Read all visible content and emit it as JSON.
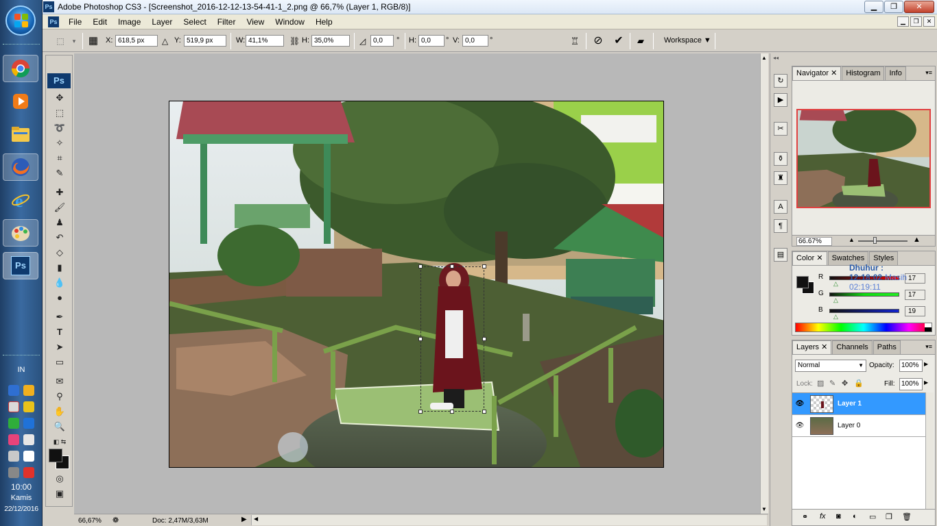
{
  "taskbar": {
    "apps": [
      "Chrome",
      "Media Player",
      "File Explorer",
      "Firefox",
      "Internet Explorer",
      "Paint",
      "Photoshop"
    ],
    "lang": "IN",
    "time": "10:00",
    "day": "Kamis",
    "date": "22/12/2016"
  },
  "window": {
    "title": "Adobe Photoshop CS3 - [Screenshot_2016-12-12-13-54-41-1_2.png @ 66,7% (Layer 1, RGB/8)]",
    "ps_logo": "Ps"
  },
  "menu": [
    "File",
    "Edit",
    "Image",
    "Layer",
    "Select",
    "Filter",
    "View",
    "Window",
    "Help"
  ],
  "options": {
    "x_label": "X:",
    "x_value": "618,5 px",
    "y_label": "Y:",
    "y_value": "519,9 px",
    "w_label": "W:",
    "w_value": "41,1%",
    "h_label": "H:",
    "h_value": "35,0%",
    "angle_value": "0,0",
    "deg": "°",
    "hskew_label": "H:",
    "hskew_value": "0,0",
    "vskew_label": "V:",
    "vskew_value": "0,0",
    "workspace": "Workspace"
  },
  "status": {
    "zoom": "66,67%",
    "doc": "Doc: 2,47M/3,63M"
  },
  "navigator": {
    "tabs": [
      "Navigator",
      "Histogram",
      "Info"
    ],
    "zoom": "66.67%"
  },
  "color": {
    "tabs": [
      "Color",
      "Swatches",
      "Styles"
    ],
    "r_label": "R",
    "r_value": "17",
    "g_label": "G",
    "g_value": "17",
    "b_label": "B",
    "b_value": "19"
  },
  "prayer": {
    "label": "Dhuhur : 12:18:02",
    "next": "Masih 02:19:11"
  },
  "layers": {
    "tabs": [
      "Layers",
      "Channels",
      "Paths"
    ],
    "blend_mode": "Normal",
    "opacity_label": "Opacity:",
    "opacity_value": "100%",
    "lock_label": "Lock:",
    "fill_label": "Fill:",
    "fill_value": "100%",
    "items": [
      {
        "name": "Layer 1",
        "selected": true
      },
      {
        "name": "Layer 0",
        "selected": false
      }
    ]
  }
}
